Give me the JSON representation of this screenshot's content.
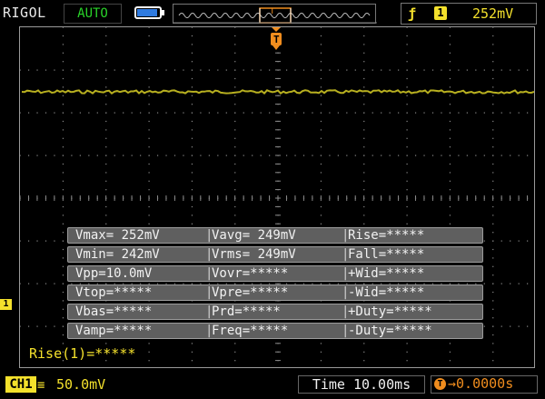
{
  "header": {
    "brand": "RIGOL",
    "run_mode": "AUTO",
    "trigger_source_channel": "1",
    "trigger_level": "252mV",
    "trigger_edge_icon": "rising-edge-icon"
  },
  "channel": {
    "badge": "CH1",
    "coupling_icon": "dc-coupling-icon",
    "scale": "50.0mV",
    "marker": "1",
    "color": "#f4e12c"
  },
  "timebase": {
    "label": "Time",
    "value": "10.00ms",
    "text": "Time 10.00ms"
  },
  "trigger_offset": {
    "value": "0.0000s"
  },
  "measurements": [
    [
      "Vmax= 252mV",
      "Vavg= 249mV",
      "Rise=*****"
    ],
    [
      "Vmin= 242mV",
      "Vrms= 249mV",
      "Fall=*****"
    ],
    [
      "Vpp=10.0mV",
      "Vovr=*****",
      "+Wid=*****"
    ],
    [
      "Vtop=*****",
      "Vpre=*****",
      "-Wid=*****"
    ],
    [
      "Vbas=*****",
      "Prd=*****",
      "+Duty=*****"
    ],
    [
      "Vamp=*****",
      "Freq=*****",
      "-Duty=*****"
    ]
  ],
  "cursor_readout": "Rise(1)=*****",
  "trigger_marker": "T",
  "colors": {
    "trace": "#b8b020",
    "trigger": "#f08d1e",
    "grid": "#8a8a8a",
    "panel": "#5f5f5f"
  }
}
